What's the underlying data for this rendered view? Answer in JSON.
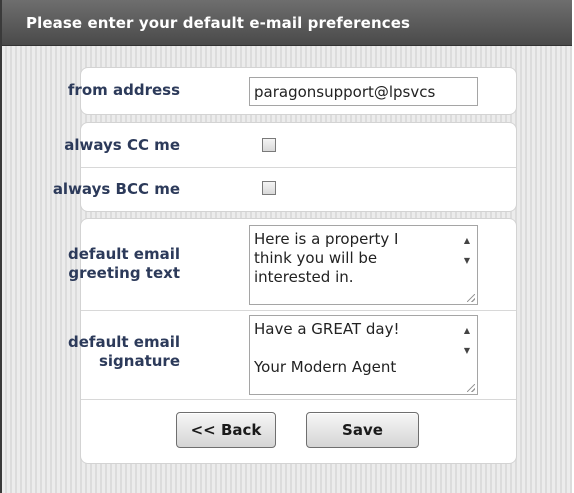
{
  "header": {
    "title": "Please enter your default e-mail preferences"
  },
  "form": {
    "from_address": {
      "label": "from address",
      "value": "paragonsupport@lpsvcs"
    },
    "always_cc": {
      "label": "always CC me",
      "checked": false
    },
    "always_bcc": {
      "label": "always BCC me",
      "checked": false
    },
    "greeting": {
      "label_line1": "default email",
      "label_line2": "greeting text",
      "value": "Here is a property I\nthink you will be\ninterested in."
    },
    "signature": {
      "label_line1": "default email",
      "label_line2": "signature",
      "value": "Have a GREAT day!\n\nYour Modern Agent"
    }
  },
  "buttons": {
    "back_label": "<< Back",
    "save_label": "Save"
  },
  "icons": {
    "scroll_up": "scroll-up-arrow-icon",
    "scroll_down": "scroll-down-arrow-icon",
    "resize": "resize-grip-icon"
  }
}
